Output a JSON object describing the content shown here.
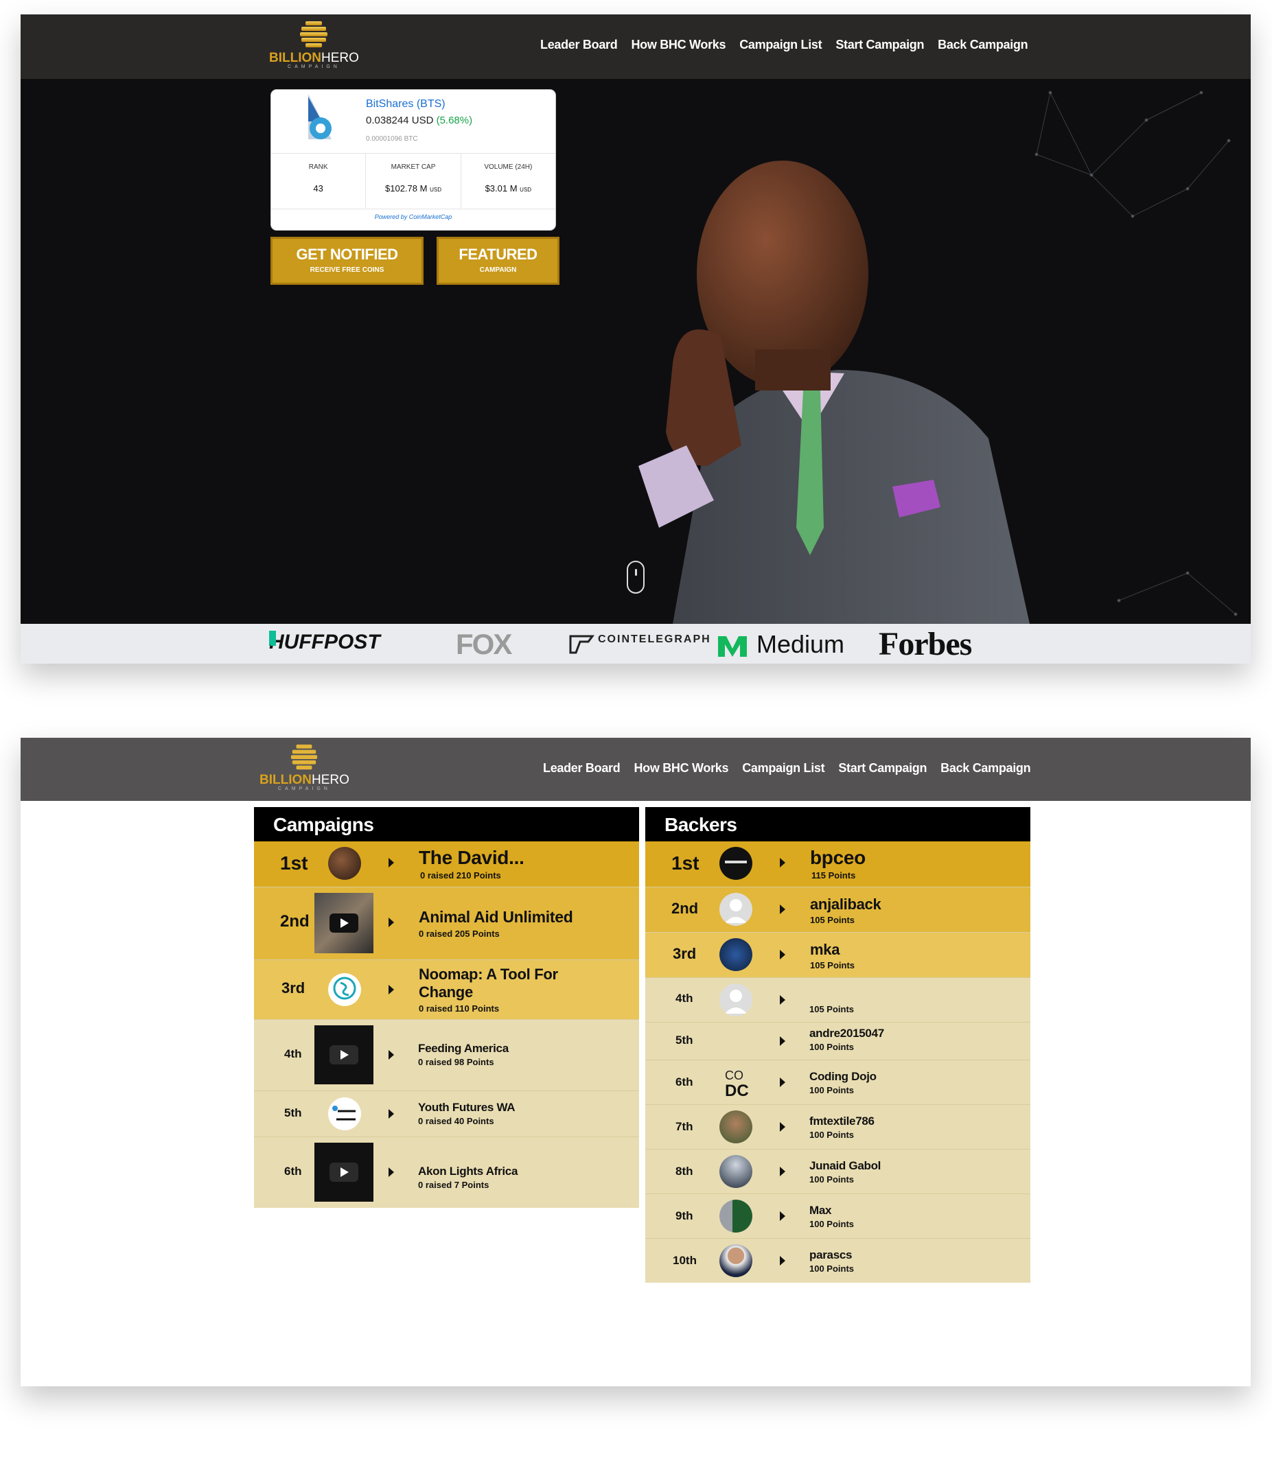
{
  "brand": {
    "name_part1": "BILLION",
    "name_part2": "HERO",
    "tagline": "CAMPAIGN",
    "accent_color": "#d9a21d"
  },
  "nav": {
    "items": [
      "Leader Board",
      "How BHC Works",
      "Campaign List",
      "Start Campaign",
      "Back Campaign"
    ]
  },
  "ticker": {
    "name": "BitShares (BTS)",
    "price": "0.038244 USD",
    "change": "(5.68%)",
    "btc": "0.00001096 BTC",
    "stats": [
      {
        "label": "RANK",
        "value": "43",
        "unit": ""
      },
      {
        "label": "MARKET CAP",
        "value": "$102.78 M",
        "unit": "USD"
      },
      {
        "label": "VOLUME (24H)",
        "value": "$3.01 M",
        "unit": "USD"
      }
    ],
    "powered": "Powered by CoinMarketCap"
  },
  "cta": [
    {
      "title": "GET NOTIFIED",
      "sub": "RECEIVE FREE COINS"
    },
    {
      "title": "FEATURED",
      "sub": "CAMPAIGN"
    }
  ],
  "press": [
    "HUFFPOST",
    "FOX",
    "COINTELEGRAPH",
    "Medium",
    "Forbes"
  ],
  "campaigns": {
    "title": "Campaigns",
    "rows": [
      {
        "rank": "1st",
        "name": "The David...",
        "sub": "0 raised 210 Points"
      },
      {
        "rank": "2nd",
        "name": "Animal Aid Unlimited",
        "sub": "0 raised 205 Points"
      },
      {
        "rank": "3rd",
        "name": "Noomap: A Tool For Change",
        "sub": "0 raised 110 Points"
      },
      {
        "rank": "4th",
        "name": "Feeding America",
        "sub": "0 raised 98 Points"
      },
      {
        "rank": "5th",
        "name": "Youth Futures WA",
        "sub": "0 raised 40 Points"
      },
      {
        "rank": "6th",
        "name": "Akon Lights Africa",
        "sub": "0 raised 7 Points"
      }
    ]
  },
  "backers": {
    "title": "Backers",
    "rows": [
      {
        "rank": "1st",
        "name": "bpceo",
        "sub": "115 Points"
      },
      {
        "rank": "2nd",
        "name": "anjaliback",
        "sub": "105 Points"
      },
      {
        "rank": "3rd",
        "name": "mka",
        "sub": "105 Points"
      },
      {
        "rank": "4th",
        "name": "",
        "sub": "105 Points"
      },
      {
        "rank": "5th",
        "name": "andre2015047",
        "sub": "100 Points"
      },
      {
        "rank": "6th",
        "name": "Coding Dojo",
        "sub": "100 Points"
      },
      {
        "rank": "7th",
        "name": "fmtextile786",
        "sub": "100 Points"
      },
      {
        "rank": "8th",
        "name": "Junaid Gabol",
        "sub": "100 Points"
      },
      {
        "rank": "9th",
        "name": "Max",
        "sub": "100 Points"
      },
      {
        "rank": "10th",
        "name": "parascs",
        "sub": "100 Points"
      }
    ]
  },
  "colors": {
    "gold_1": "#dba91f",
    "gold_2": "#e2b73b",
    "gold_3": "#e9c55a",
    "tan": "#e8dcb2"
  }
}
